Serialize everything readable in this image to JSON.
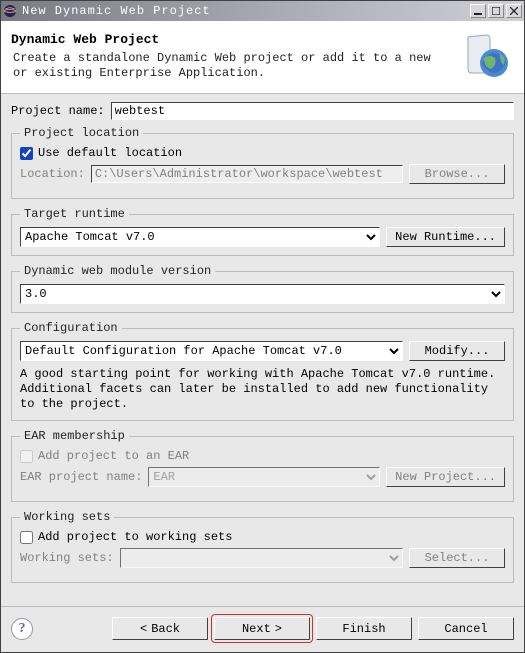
{
  "window": {
    "title": "New Dynamic Web Project"
  },
  "banner": {
    "title": "Dynamic Web Project",
    "description": "Create a standalone Dynamic Web project or add it to a new or existing Enterprise Application."
  },
  "project_name": {
    "label": "Project name:",
    "value": "webtest"
  },
  "location": {
    "legend": "Project location",
    "use_default_label": "Use default location",
    "use_default_checked": true,
    "location_label": "Location:",
    "location_value": "C:\\Users\\Administrator\\workspace\\webtest",
    "browse_label": "Browse..."
  },
  "runtime": {
    "legend": "Target runtime",
    "selected": "Apache Tomcat v7.0",
    "new_button": "New Runtime..."
  },
  "dwmv": {
    "legend": "Dynamic web module version",
    "selected": "3.0"
  },
  "config": {
    "legend": "Configuration",
    "selected": "Default Configuration for Apache Tomcat v7.0",
    "modify_button": "Modify...",
    "description": "A good starting point for working with Apache Tomcat v7.0 runtime. Additional facets can later be installed to add new functionality to the project."
  },
  "ear": {
    "legend": "EAR membership",
    "add_label": "Add project to an EAR",
    "add_checked": false,
    "proj_label": "EAR project name:",
    "proj_value": "EAR",
    "new_button": "New Project..."
  },
  "ws": {
    "legend": "Working sets",
    "add_label": "Add project to working sets",
    "add_checked": false,
    "ws_label": "Working sets:",
    "ws_value": "",
    "select_button": "Select..."
  },
  "buttons": {
    "help": "?",
    "back": "Back",
    "next": "Next",
    "finish": "Finish",
    "cancel": "Cancel"
  }
}
